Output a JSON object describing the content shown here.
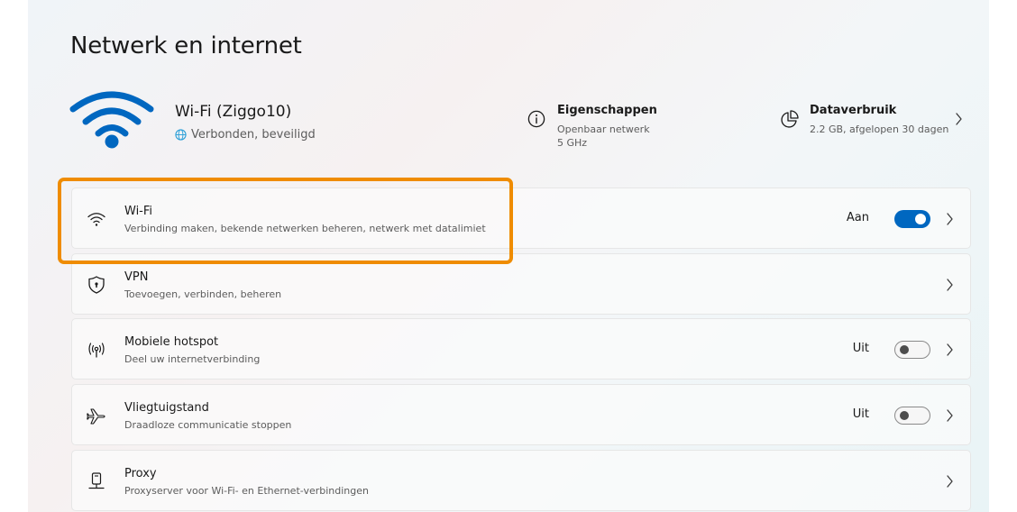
{
  "page": {
    "title": "Netwerk en internet"
  },
  "connection": {
    "name": "Wi-Fi (Ziggo10)",
    "status": "Verbonden, beveiligd"
  },
  "properties": {
    "title": "Eigenschappen",
    "line1": "Openbaar netwerk",
    "line2": "5 GHz"
  },
  "data_usage": {
    "title": "Dataverbruik",
    "detail": "2.2 GB, afgelopen 30 dagen"
  },
  "items": [
    {
      "title": "Wi-Fi",
      "subtitle": "Verbinding maken, bekende netwerken beheren, netwerk met datalimiet",
      "state": "Aan",
      "icon": "wifi-icon"
    },
    {
      "title": "VPN",
      "subtitle": "Toevoegen, verbinden, beheren",
      "icon": "shield-icon"
    },
    {
      "title": "Mobiele hotspot",
      "subtitle": "Deel uw internetverbinding",
      "state": "Uit",
      "icon": "hotspot-icon"
    },
    {
      "title": "Vliegtuigstand",
      "subtitle": "Draadloze communicatie stoppen",
      "state": "Uit",
      "icon": "airplane-icon"
    },
    {
      "title": "Proxy",
      "subtitle": "Proxyserver voor Wi-Fi- en Ethernet-verbindingen",
      "icon": "proxy-icon"
    }
  ],
  "colors": {
    "accent": "#0067c0",
    "highlight": "#ef8c00"
  }
}
